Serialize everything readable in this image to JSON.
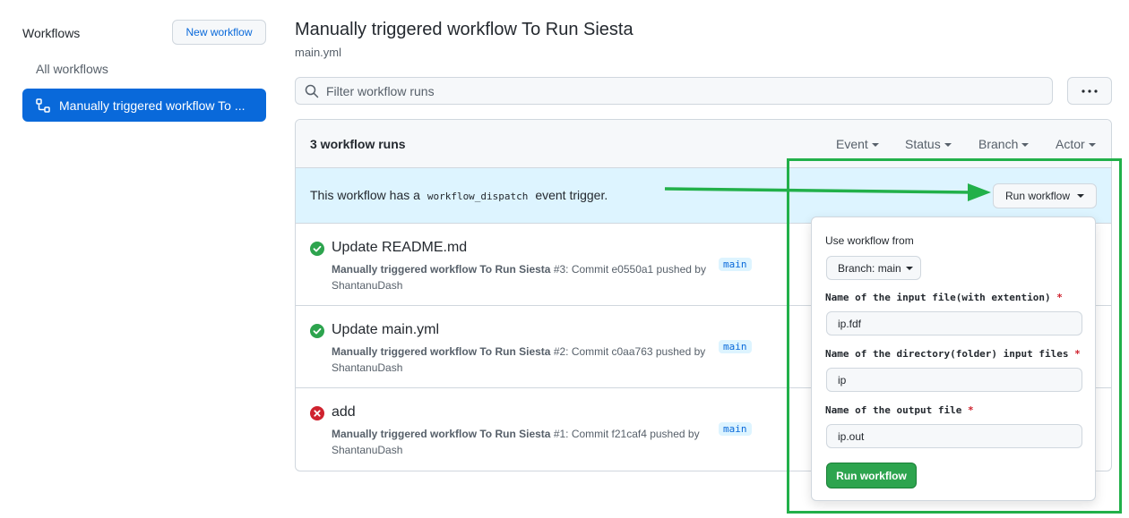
{
  "sidebar": {
    "title": "Workflows",
    "new_button": "New workflow",
    "all_workflows": "All workflows",
    "active_item": "Manually triggered workflow To ..."
  },
  "header": {
    "title": "Manually triggered workflow To Run Siesta",
    "subtitle": "main.yml"
  },
  "search": {
    "placeholder": "Filter workflow runs"
  },
  "runs": {
    "count_label": "3 workflow runs",
    "filters": [
      "Event",
      "Status",
      "Branch",
      "Actor"
    ],
    "dispatch": {
      "prefix": "This workflow has a",
      "code": "workflow_dispatch",
      "suffix": "event trigger.",
      "button": "Run workflow"
    },
    "items": [
      {
        "status": "success",
        "title": "Update README.md",
        "workflow": "Manually triggered workflow To Run Siesta",
        "detail": "#3: Commit e0550a1 pushed by",
        "actor": "ShantanuDash",
        "branch": "main"
      },
      {
        "status": "success",
        "title": "Update main.yml",
        "workflow": "Manually triggered workflow To Run Siesta",
        "detail": "#2: Commit c0aa763 pushed by",
        "actor": "ShantanuDash",
        "branch": "main"
      },
      {
        "status": "failure",
        "title": "add",
        "workflow": "Manually triggered workflow To Run Siesta",
        "detail": "#1: Commit f21caf4 pushed by",
        "actor": "ShantanuDash",
        "branch": "main"
      }
    ]
  },
  "dropdown": {
    "use_from_label": "Use workflow from",
    "branch_button": "Branch: main",
    "field1_label": "Name of the input file(with extention)",
    "field1_value": "ip.fdf",
    "field2_label": "Name of the directory(folder) input files",
    "field2_value": "ip",
    "field3_label": "Name of the output file",
    "field3_value": "ip.out",
    "required_mark": "*",
    "run_button": "Run workflow"
  },
  "colors": {
    "accent": "#0969da",
    "success": "#2da44e",
    "failure": "#cf222e",
    "highlight": "#22b04a"
  }
}
